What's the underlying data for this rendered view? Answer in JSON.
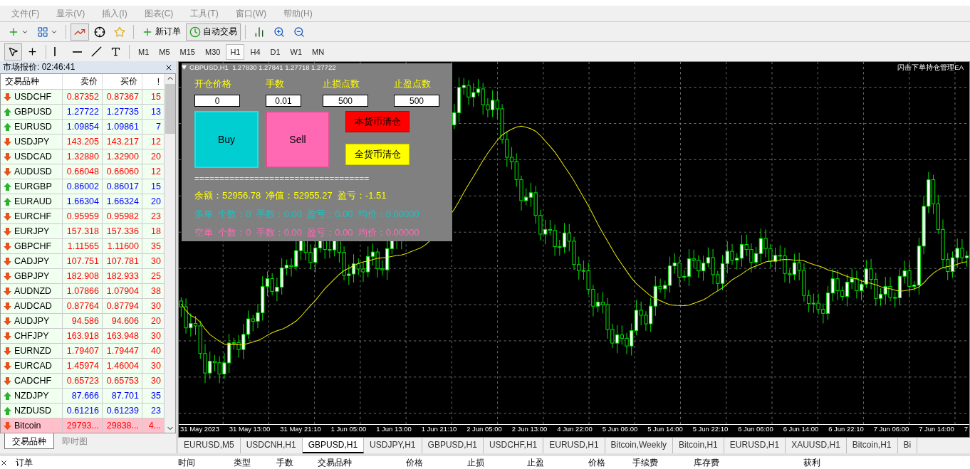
{
  "menu": [
    {
      "label": "文件(F)"
    },
    {
      "label": "显示(V)"
    },
    {
      "label": "插入(I)"
    },
    {
      "label": "图表(C)"
    },
    {
      "label": "工具(T)"
    },
    {
      "label": "窗口(W)"
    },
    {
      "label": "帮助(H)"
    }
  ],
  "toolbar": {
    "new_order": "新订单",
    "auto_trading": {
      "label": "自动交易",
      "on": true
    }
  },
  "timeframes": [
    {
      "label": "M1",
      "selected": false
    },
    {
      "label": "M5",
      "selected": false
    },
    {
      "label": "M15",
      "selected": false
    },
    {
      "label": "M30",
      "selected": false
    },
    {
      "label": "H1",
      "selected": true
    },
    {
      "label": "H4",
      "selected": false
    },
    {
      "label": "D1",
      "selected": false
    },
    {
      "label": "W1",
      "selected": false
    },
    {
      "label": "MN",
      "selected": false
    }
  ],
  "market_watch": {
    "title": "市场报价: 02:46:41",
    "columns": [
      "交易品种",
      "卖价",
      "买价",
      "!"
    ],
    "rows": [
      {
        "symbol": "USDCHF",
        "bid": "0.87352",
        "ask": "0.87367",
        "spread": "15",
        "kind": "down",
        "selected": false
      },
      {
        "symbol": "GBPUSD",
        "bid": "1.27722",
        "ask": "1.27735",
        "spread": "13",
        "kind": "up",
        "selected": false
      },
      {
        "symbol": "EURUSD",
        "bid": "1.09854",
        "ask": "1.09861",
        "spread": "7",
        "kind": "up",
        "selected": false
      },
      {
        "symbol": "USDJPY",
        "bid": "143.205",
        "ask": "143.217",
        "spread": "12",
        "kind": "down",
        "selected": false
      },
      {
        "symbol": "USDCAD",
        "bid": "1.32880",
        "ask": "1.32900",
        "spread": "20",
        "kind": "down",
        "selected": false
      },
      {
        "symbol": "AUDUSD",
        "bid": "0.66048",
        "ask": "0.66060",
        "spread": "12",
        "kind": "down",
        "selected": false
      },
      {
        "symbol": "EURGBP",
        "bid": "0.86002",
        "ask": "0.86017",
        "spread": "15",
        "kind": "up",
        "selected": false
      },
      {
        "symbol": "EURAUD",
        "bid": "1.66304",
        "ask": "1.66324",
        "spread": "20",
        "kind": "up",
        "selected": false
      },
      {
        "symbol": "EURCHF",
        "bid": "0.95959",
        "ask": "0.95982",
        "spread": "23",
        "kind": "down",
        "selected": false
      },
      {
        "symbol": "EURJPY",
        "bid": "157.318",
        "ask": "157.336",
        "spread": "18",
        "kind": "down",
        "selected": false
      },
      {
        "symbol": "GBPCHF",
        "bid": "1.11565",
        "ask": "1.11600",
        "spread": "35",
        "kind": "down",
        "selected": false
      },
      {
        "symbol": "CADJPY",
        "bid": "107.751",
        "ask": "107.781",
        "spread": "30",
        "kind": "down",
        "selected": false
      },
      {
        "symbol": "GBPJPY",
        "bid": "182.908",
        "ask": "182.933",
        "spread": "25",
        "kind": "down",
        "selected": false
      },
      {
        "symbol": "AUDNZD",
        "bid": "1.07866",
        "ask": "1.07904",
        "spread": "38",
        "kind": "down",
        "selected": false
      },
      {
        "symbol": "AUDCAD",
        "bid": "0.87764",
        "ask": "0.87794",
        "spread": "30",
        "kind": "down",
        "selected": false
      },
      {
        "symbol": "AUDJPY",
        "bid": "94.586",
        "ask": "94.606",
        "spread": "20",
        "kind": "down",
        "selected": false
      },
      {
        "symbol": "CHFJPY",
        "bid": "163.918",
        "ask": "163.948",
        "spread": "30",
        "kind": "down",
        "selected": false
      },
      {
        "symbol": "EURNZD",
        "bid": "1.79407",
        "ask": "1.79447",
        "spread": "40",
        "kind": "down",
        "selected": false
      },
      {
        "symbol": "EURCAD",
        "bid": "1.45974",
        "ask": "1.46004",
        "spread": "30",
        "kind": "down",
        "selected": false
      },
      {
        "symbol": "CADCHF",
        "bid": "0.65723",
        "ask": "0.65753",
        "spread": "30",
        "kind": "down",
        "selected": false
      },
      {
        "symbol": "NZDJPY",
        "bid": "87.666",
        "ask": "87.701",
        "spread": "35",
        "kind": "up",
        "selected": false
      },
      {
        "symbol": "NZDUSD",
        "bid": "0.61216",
        "ask": "0.61239",
        "spread": "23",
        "kind": "up",
        "selected": false
      },
      {
        "symbol": "Bitcoin",
        "bid": "29793...",
        "ask": "29838...",
        "spread": "4...",
        "kind": "down",
        "selected": true
      }
    ],
    "tabs": [
      {
        "label": "交易品种",
        "selected": true
      },
      {
        "label": "即时图",
        "selected": false
      }
    ]
  },
  "chart": {
    "title": "GBPUSD,H1  1.27830 1.27841 1.27718 1.27722",
    "ea_label": "闪击下单持仓管理EA",
    "time_labels": [
      "31 May 2023",
      "31 May 13:00",
      "31 May 21:10",
      "1 Jun 05:00",
      "1 Jun 13:00",
      "1 Jun 21:10",
      "2 Jun 05:00",
      "2 Jun 13:00",
      "4 Jun 22:00",
      "5 Jun 06:00",
      "5 Jun 14:00",
      "5 Jun 22:10",
      "6 Jun 06:00",
      "6 Jun 14:00",
      "6 Jun 22:10",
      "7 Jun 06:00",
      "7 Jun 14:00",
      "7"
    ]
  },
  "ea_panel": {
    "fields": [
      {
        "label": "开仓价格",
        "value": "0"
      },
      {
        "label": "手数",
        "value": "0.01"
      },
      {
        "label": "止损点数",
        "value": "500"
      },
      {
        "label": "止盈点数",
        "value": "500"
      }
    ],
    "buttons": [
      {
        "label": "Buy",
        "kind": "buy"
      },
      {
        "label": "Sell",
        "kind": "sell"
      },
      {
        "label": "本货币清仓",
        "kind": "close_symbol"
      },
      {
        "label": "全货币清仓",
        "kind": "close_all"
      }
    ],
    "divider": "===================================",
    "lines": [
      {
        "text": "余额：52956.78  净值：52955.27  盈亏：-1.51",
        "kind": "account"
      },
      {
        "text": "多单  个数：0  手数：0.00  盈亏：0.00  均价：0.00000",
        "kind": "long"
      },
      {
        "text": "空单  个数：0  手数：0.00  盈亏：0.00  均价：0.00000",
        "kind": "short"
      }
    ]
  },
  "chart_tabs": [
    {
      "label": "EURUSD,M5",
      "selected": false
    },
    {
      "label": "USDCNH,H1",
      "selected": false
    },
    {
      "label": "GBPUSD,H1",
      "selected": true
    },
    {
      "label": "USDJPY,H1",
      "selected": false
    },
    {
      "label": "GBPUSD,H1",
      "selected": false
    },
    {
      "label": "USDCHF,H1",
      "selected": false
    },
    {
      "label": "EURUSD,H1",
      "selected": false
    },
    {
      "label": "Bitcoin,Weekly",
      "selected": false
    },
    {
      "label": "Bitcoin,H1",
      "selected": false
    },
    {
      "label": "EURUSD,H1",
      "selected": false
    },
    {
      "label": "XAUUSD,H1",
      "selected": false
    },
    {
      "label": "Bitcoin,H1",
      "selected": false
    },
    {
      "label": "Bi",
      "selected": false
    }
  ],
  "terminal": {
    "columns": [
      "订单",
      "时间",
      "类型",
      "手数",
      "交易品种",
      "价格",
      "止损",
      "止盈",
      "价格",
      "手续费",
      "库存费",
      "获利"
    ]
  }
}
